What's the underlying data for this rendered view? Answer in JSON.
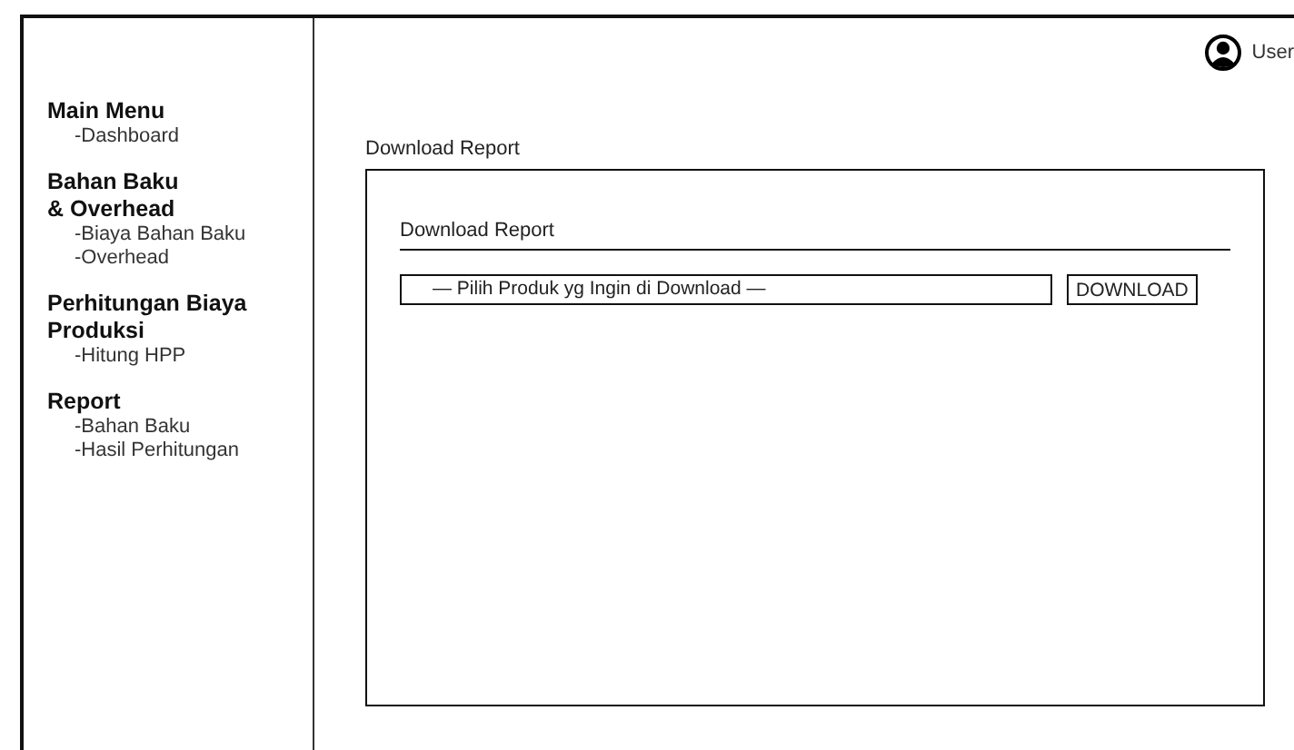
{
  "header": {
    "user": "User"
  },
  "sidebar": {
    "sections": [
      {
        "title": "Main Menu",
        "items": [
          "-Dashboard"
        ]
      },
      {
        "title": "Bahan Baku\n& Overhead",
        "items": [
          "-Biaya Bahan Baku",
          "-Overhead"
        ]
      },
      {
        "title": "Perhitungan Biaya\nProduksi",
        "items": [
          "-Hitung HPP"
        ]
      },
      {
        "title": "Report",
        "items": [
          "-Bahan Baku",
          "-Hasil Perhitungan"
        ]
      }
    ]
  },
  "page_title": "Download Report",
  "panel": {
    "title": "Download Report",
    "select": {
      "value": "— Pilih Produk yg Ingin di Download —"
    },
    "button": "DOWNLOAD"
  }
}
